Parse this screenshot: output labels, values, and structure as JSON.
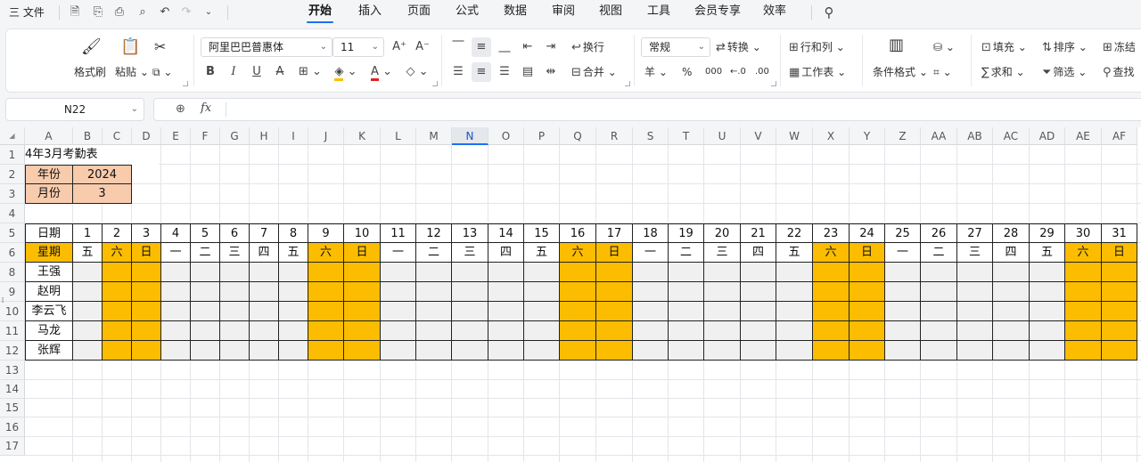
{
  "menubar": {
    "file_label": "三 文件",
    "tabs": [
      "开始",
      "插入",
      "页面",
      "公式",
      "数据",
      "审阅",
      "视图",
      "工具",
      "会员专享",
      "效率"
    ],
    "active_tab": "开始"
  },
  "ribbon": {
    "format_painter": "格式刷",
    "paste": "粘贴",
    "font_name": "阿里巴巴普惠体",
    "font_size": "11",
    "wrap_text": "换行",
    "merge": "合并",
    "number_format": "常规",
    "convert": "转换",
    "rows_cols": "行和列",
    "worksheet": "工作表",
    "conditional_format": "条件格式",
    "fill": "填充",
    "sort": "排序",
    "freeze": "冻结",
    "sum": "求和",
    "filter": "筛选",
    "find": "查找",
    "currency_symbol": "羊",
    "percent_symbol": "%"
  },
  "formula_bar": {
    "name_box": "N22",
    "fx_label": "fx",
    "content": ""
  },
  "sheet": {
    "columns": [
      "A",
      "B",
      "C",
      "D",
      "E",
      "F",
      "G",
      "H",
      "I",
      "J",
      "K",
      "L",
      "M",
      "N",
      "O",
      "P",
      "Q",
      "R",
      "S",
      "T",
      "U",
      "V",
      "W",
      "X",
      "Y",
      "Z",
      "AA",
      "AB",
      "AC",
      "AD",
      "AE",
      "AF"
    ],
    "selected_column": "N",
    "row_numbers": [
      "1",
      "2",
      "3",
      "4",
      "5",
      "6",
      "8",
      "9",
      "10",
      "11",
      "12",
      "13",
      "14",
      "15",
      "16",
      "17"
    ],
    "title": "4年3月考勤表",
    "year_label": "年份",
    "year_value": "2024",
    "month_label": "月份",
    "month_value": "3",
    "date_label": "日期",
    "weekday_label": "星期",
    "dates": [
      "1",
      "2",
      "3",
      "4",
      "5",
      "6",
      "7",
      "8",
      "9",
      "10",
      "11",
      "12",
      "13",
      "14",
      "15",
      "16",
      "17",
      "18",
      "19",
      "20",
      "21",
      "22",
      "23",
      "24",
      "25",
      "26",
      "27",
      "28",
      "29",
      "30",
      "31"
    ],
    "weekdays": [
      "五",
      "六",
      "日",
      "一",
      "二",
      "三",
      "四",
      "五",
      "六",
      "日",
      "一",
      "二",
      "三",
      "四",
      "五",
      "六",
      "日",
      "一",
      "二",
      "三",
      "四",
      "五",
      "六",
      "日",
      "一",
      "二",
      "三",
      "四",
      "五",
      "六",
      "日"
    ],
    "weekend_flags": [
      0,
      1,
      1,
      0,
      0,
      0,
      0,
      0,
      1,
      1,
      0,
      0,
      0,
      0,
      0,
      1,
      1,
      0,
      0,
      0,
      0,
      0,
      1,
      1,
      0,
      0,
      0,
      0,
      0,
      1,
      1
    ],
    "employees": [
      "王强",
      "赵明",
      "李云飞",
      "马龙",
      "张辉"
    ],
    "colors": {
      "weekend": "#fcbd00",
      "header_fill": "#f8cbad",
      "weekday_fill": "#f0f0f0",
      "accent": "#1d6ff2"
    }
  }
}
